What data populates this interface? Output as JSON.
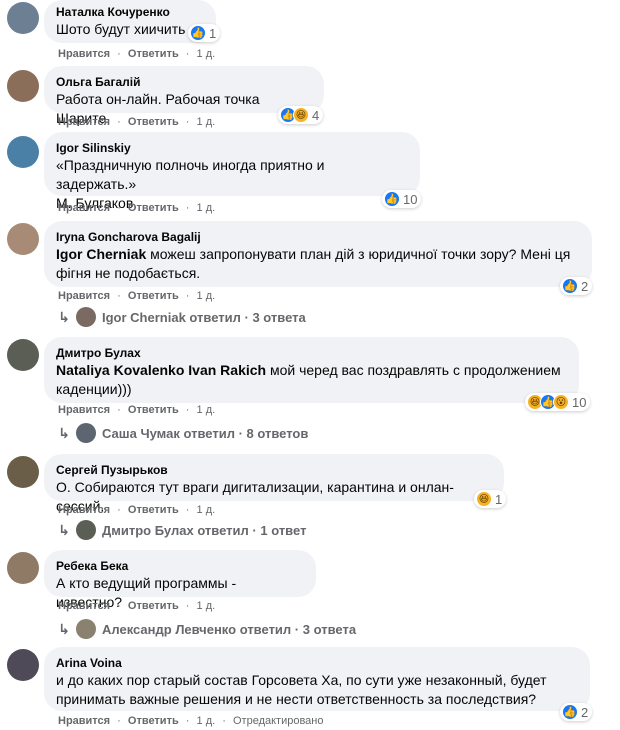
{
  "actions": {
    "like": "Нравится",
    "reply": "Ответить",
    "dot": "·",
    "time": "1 д."
  },
  "comments": [
    {
      "author": "Наталка Кочуренко",
      "lines": [
        "Шото будут хиичить"
      ],
      "react_count": "1",
      "reacts": [
        "like"
      ]
    },
    {
      "author": "Ольга Багалій",
      "lines": [
        "Работа он-лайн. Рабочая точка Шарите."
      ],
      "react_count": "4",
      "reacts": [
        "like",
        "haha"
      ]
    },
    {
      "author": "Igor Silinskiy",
      "lines": [
        "«Праздничную полночь иногда приятно и задержать.»",
        "М. Булгаков."
      ],
      "react_count": "10",
      "reacts": [
        "like"
      ]
    },
    {
      "author": "Iryna Goncharova Bagalij",
      "mention": "Igor Cherniak",
      "lines": [
        " можеш запропонувати план дій з юридичної точки зору? Мені ця",
        "фігня не подобається."
      ],
      "react_count": "2",
      "reacts": [
        "like"
      ],
      "replies": {
        "name": "Igor Cherniak",
        "text": "ответил",
        "count": "3 ответа"
      }
    },
    {
      "author": "Дмитро Булах",
      "mention": "Nataliya Kovalenko Ivan Rakich",
      "lines": [
        " мой черед вас поздравлять с продолжением",
        "каденции)))"
      ],
      "react_count": "10",
      "reacts": [
        "haha",
        "like",
        "wow"
      ],
      "replies": {
        "name": "Саша Чумак",
        "text": "ответил",
        "count": "8 ответов"
      }
    },
    {
      "author": "Сергей Пузырьков",
      "lines": [
        "О. Собираются тут враги дигитализации, карантина и онлан-сессий."
      ],
      "react_count": "1",
      "reacts": [
        "haha"
      ],
      "replies": {
        "name": "Дмитро Булах",
        "text": "ответил",
        "count": "1 ответ"
      }
    },
    {
      "author": "Ребека Бека",
      "lines": [
        "А кто ведущий программы - известно?"
      ],
      "replies": {
        "name": "Александр Левченко",
        "text": "ответил",
        "count": "3 ответа"
      }
    },
    {
      "author": "Arina Voina",
      "lines": [
        "и до каких пор старый состав Горсовета Ха, по сути уже незаконный, будет",
        "принимать важные решения и не нести ответственность за последствия?"
      ],
      "react_count": "2",
      "reacts": [
        "like"
      ],
      "edited": "Отредактировано"
    }
  ]
}
